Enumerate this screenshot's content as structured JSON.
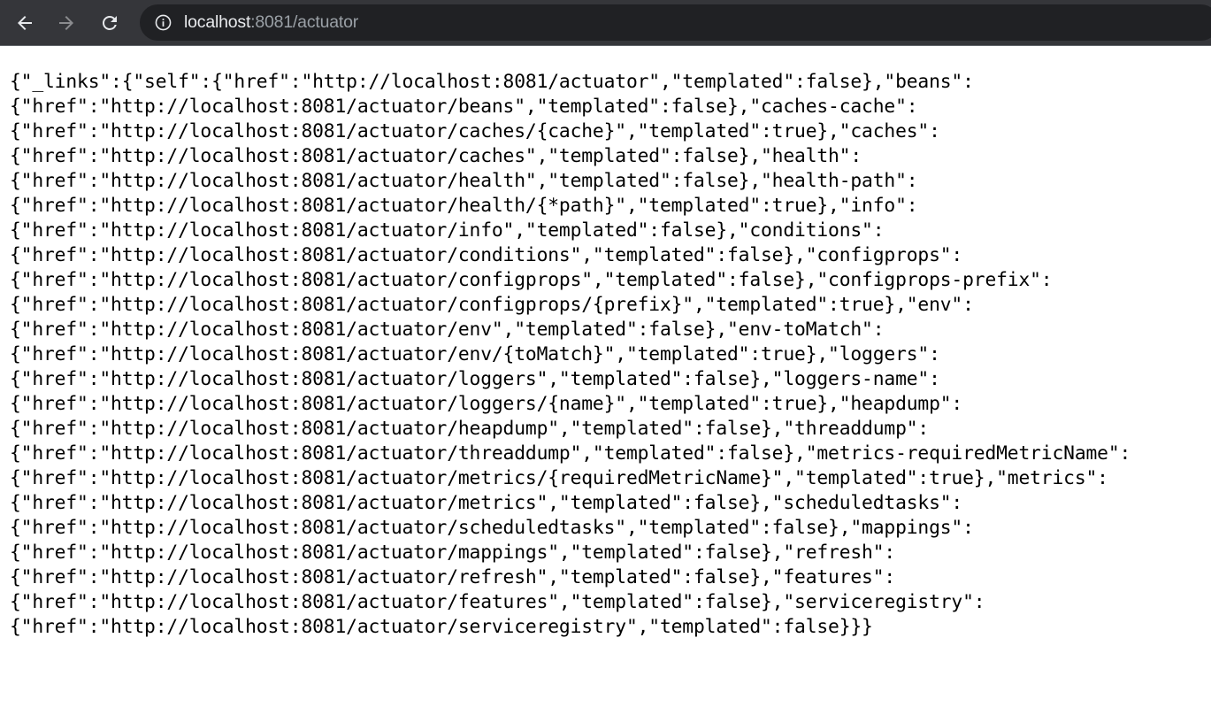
{
  "browser": {
    "url_host": "localhost",
    "url_path": ":8081/actuator",
    "colors": {
      "toolbar_bg": "#35363a",
      "omnibox_bg": "#202124",
      "host_text": "#e8eaed",
      "path_text": "#9aa0a6",
      "icon": "#e8eaed",
      "icon_disabled": "#8b8c8f"
    },
    "icons": {
      "back": "arrow-left-icon",
      "forward": "arrow-right-icon",
      "reload": "reload-icon",
      "site_info": "info-circle-icon"
    }
  },
  "json_body": {
    "lines": [
      "{\"_links\":{\"self\":{\"href\":\"http://localhost:8081/actuator\",\"templated\":false},\"beans\":",
      "{\"href\":\"http://localhost:8081/actuator/beans\",\"templated\":false},\"caches-cache\":",
      "{\"href\":\"http://localhost:8081/actuator/caches/{cache}\",\"templated\":true},\"caches\":",
      "{\"href\":\"http://localhost:8081/actuator/caches\",\"templated\":false},\"health\":",
      "{\"href\":\"http://localhost:8081/actuator/health\",\"templated\":false},\"health-path\":",
      "{\"href\":\"http://localhost:8081/actuator/health/{*path}\",\"templated\":true},\"info\":",
      "{\"href\":\"http://localhost:8081/actuator/info\",\"templated\":false},\"conditions\":",
      "{\"href\":\"http://localhost:8081/actuator/conditions\",\"templated\":false},\"configprops\":",
      "{\"href\":\"http://localhost:8081/actuator/configprops\",\"templated\":false},\"configprops-prefix\":",
      "{\"href\":\"http://localhost:8081/actuator/configprops/{prefix}\",\"templated\":true},\"env\":",
      "{\"href\":\"http://localhost:8081/actuator/env\",\"templated\":false},\"env-toMatch\":",
      "{\"href\":\"http://localhost:8081/actuator/env/{toMatch}\",\"templated\":true},\"loggers\":",
      "{\"href\":\"http://localhost:8081/actuator/loggers\",\"templated\":false},\"loggers-name\":",
      "{\"href\":\"http://localhost:8081/actuator/loggers/{name}\",\"templated\":true},\"heapdump\":",
      "{\"href\":\"http://localhost:8081/actuator/heapdump\",\"templated\":false},\"threaddump\":",
      "{\"href\":\"http://localhost:8081/actuator/threaddump\",\"templated\":false},\"metrics-requiredMetricName\":",
      "{\"href\":\"http://localhost:8081/actuator/metrics/{requiredMetricName}\",\"templated\":true},\"metrics\":",
      "{\"href\":\"http://localhost:8081/actuator/metrics\",\"templated\":false},\"scheduledtasks\":",
      "{\"href\":\"http://localhost:8081/actuator/scheduledtasks\",\"templated\":false},\"mappings\":",
      "{\"href\":\"http://localhost:8081/actuator/mappings\",\"templated\":false},\"refresh\":",
      "{\"href\":\"http://localhost:8081/actuator/refresh\",\"templated\":false},\"features\":",
      "{\"href\":\"http://localhost:8081/actuator/features\",\"templated\":false},\"serviceregistry\":",
      "{\"href\":\"http://localhost:8081/actuator/serviceregistry\",\"templated\":false}}}"
    ]
  }
}
